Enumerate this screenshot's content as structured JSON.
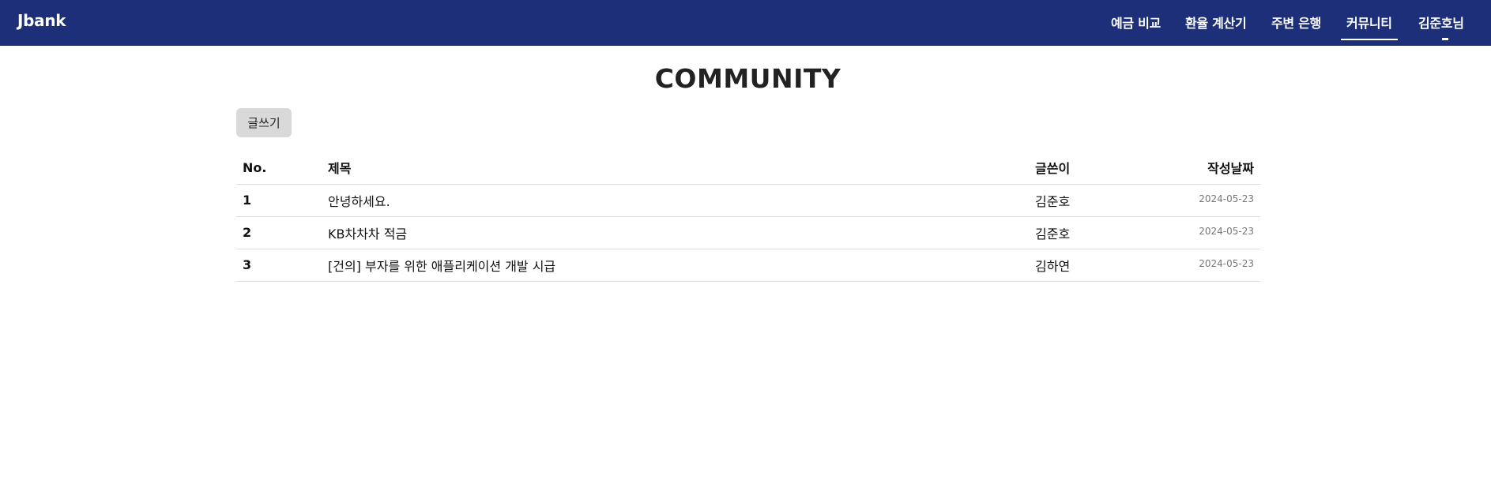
{
  "navbar": {
    "brand": "Jbank",
    "items": [
      {
        "label": "예금 비교",
        "active": false
      },
      {
        "label": "환율 계산기",
        "active": false
      },
      {
        "label": "주변 은행",
        "active": false
      },
      {
        "label": "커뮤니티",
        "active": true
      },
      {
        "label": "김준호님",
        "active": false
      }
    ],
    "background_color": "#1c2f78"
  },
  "page": {
    "title": "COMMUNITY",
    "write_button_label": "글쓰기"
  },
  "table": {
    "headers": [
      "No.",
      "제목",
      "글쓴이",
      "작성날짜"
    ],
    "rows": [
      {
        "no": "1",
        "title": "안녕하세요.",
        "author": "김준호",
        "date": "2024-05-23"
      },
      {
        "no": "2",
        "title": "KB차차차 적금",
        "author": "김준호",
        "date": "2024-05-23"
      },
      {
        "no": "3",
        "title": "[건의] 부자를 위한 애플리케이션 개발 시급",
        "author": "김하연",
        "date": "2024-05-23"
      }
    ]
  }
}
